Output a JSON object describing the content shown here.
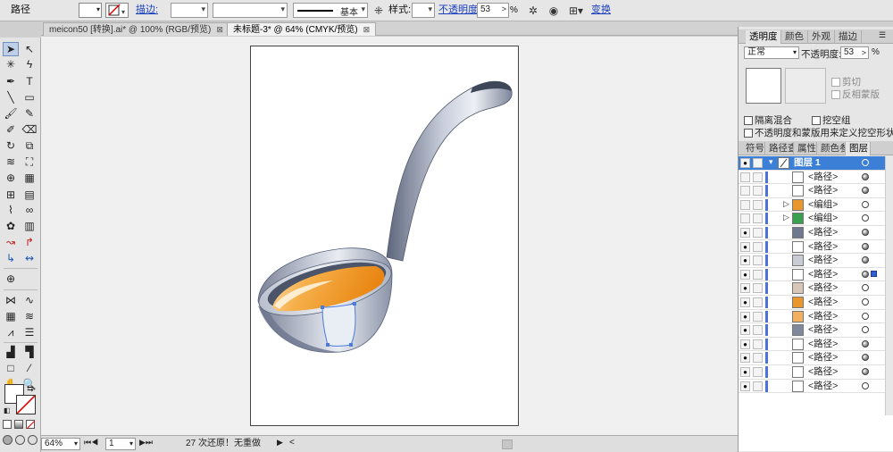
{
  "control_bar": {
    "object_label": "路径",
    "stroke_label": "描边:",
    "stroke_profile": "基本",
    "style_label": "样式:",
    "opacity_label": "不透明度:",
    "opacity_value": "53",
    "opacity_unit": "%",
    "transform_label": "变换"
  },
  "tabs": [
    {
      "label": "meicon50 [转换].ai* @ 100% (RGB/预览)",
      "active": false
    },
    {
      "label": "未标题-3* @ 64% (CMYK/预览)",
      "active": true
    }
  ],
  "status_bar": {
    "zoom": "64%",
    "artboard": "1",
    "history": "27 次还原",
    "redo": "无重做"
  },
  "transparency_panel": {
    "tabs": [
      "透明度",
      "颜色",
      "外观",
      "描边"
    ],
    "blend_mode": "正常",
    "opacity_label": "不透明度:",
    "opacity_value": "53",
    "opacity_unit": "%",
    "clip_label": "剪切",
    "invert_mask_label": "反相蒙版",
    "isolate_label": "隔离混合",
    "knockout_label": "挖空组",
    "opacity_mask_label": "不透明度和蒙版用来定义挖空形状"
  },
  "layers_panel": {
    "tabs": [
      "符号",
      "路径查",
      "属性",
      "颜色参",
      "图层"
    ],
    "layer_name": "图层 1",
    "items": [
      {
        "name": "<路径>",
        "visible": false,
        "target": "filled"
      },
      {
        "name": "<路径>",
        "visible": false,
        "target": "filled"
      },
      {
        "name": "<编组>",
        "visible": false,
        "target": "empty",
        "group": true
      },
      {
        "name": "<编组>",
        "visible": false,
        "target": "empty",
        "group": true
      },
      {
        "name": "<路径>",
        "visible": true,
        "target": "filled"
      },
      {
        "name": "<路径>",
        "visible": true,
        "target": "filled"
      },
      {
        "name": "<路径>",
        "visible": true,
        "target": "filled"
      },
      {
        "name": "<路径>",
        "visible": true,
        "target": "filled",
        "selected": true
      },
      {
        "name": "<路径>",
        "visible": true,
        "target": "empty"
      },
      {
        "name": "<路径>",
        "visible": true,
        "target": "empty"
      },
      {
        "name": "<路径>",
        "visible": true,
        "target": "empty"
      },
      {
        "name": "<路径>",
        "visible": true,
        "target": "empty"
      },
      {
        "name": "<路径>",
        "visible": true,
        "target": "filled"
      },
      {
        "name": "<路径>",
        "visible": true,
        "target": "filled"
      },
      {
        "name": "<路径>",
        "visible": true,
        "target": "filled"
      },
      {
        "name": "<路径>",
        "visible": true,
        "target": "empty"
      }
    ]
  },
  "colors": {
    "selection_blue": "#3b7fd6",
    "ladle_orange": "#f29a1a",
    "ladle_gray": "#9aa3b4"
  }
}
